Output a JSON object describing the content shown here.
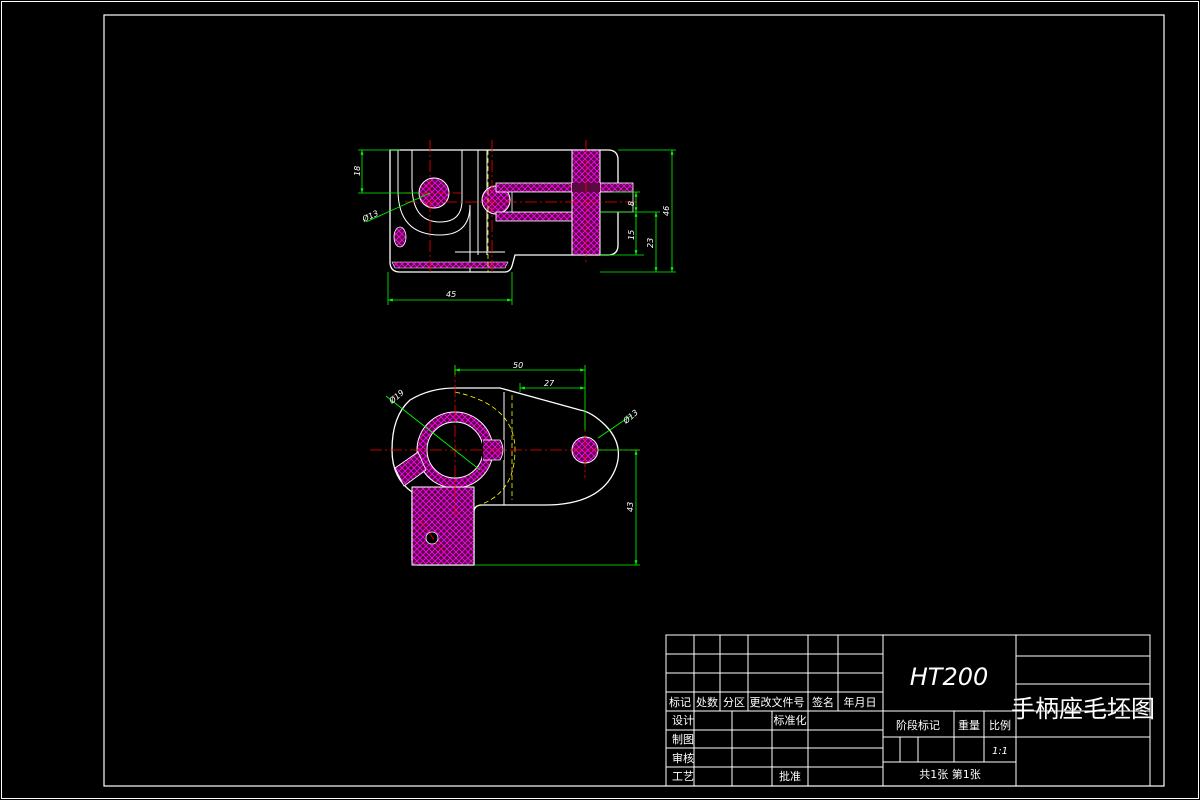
{
  "colors": {
    "background": "#000000",
    "outline": "#ffffff",
    "dimension": "#00ff00",
    "centerline": "#ff0000",
    "hidden": "#ffff00",
    "hatch": "#ff00ff"
  },
  "front_view": {
    "dims": {
      "height_top": "18",
      "hole_dia": "Ø13",
      "slot_width": "8",
      "slot_offset": "15",
      "lower_height": "23",
      "total_height": "46",
      "base_length": "45"
    }
  },
  "top_view": {
    "dims": {
      "center_distance": "50",
      "offset": "27",
      "boss_dia": "Ø19",
      "end_hole_dia": "Ø13",
      "depth": "43"
    }
  },
  "title_block": {
    "material": "HT200",
    "drawing_name": "手柄座毛坯图",
    "rev_headers": [
      "标记",
      "处数",
      "分区",
      "更改文件号",
      "签名",
      "年月日"
    ],
    "row_design": "设计",
    "row_standard": "标准化",
    "row_drawn": "制图",
    "row_check": "审核",
    "row_process": "工艺",
    "row_approve": "批准",
    "stage_mark": "阶段标记",
    "weight": "重量",
    "scale_label": "比例",
    "scale_value": "1:1",
    "sheets": "共1张  第1张"
  }
}
